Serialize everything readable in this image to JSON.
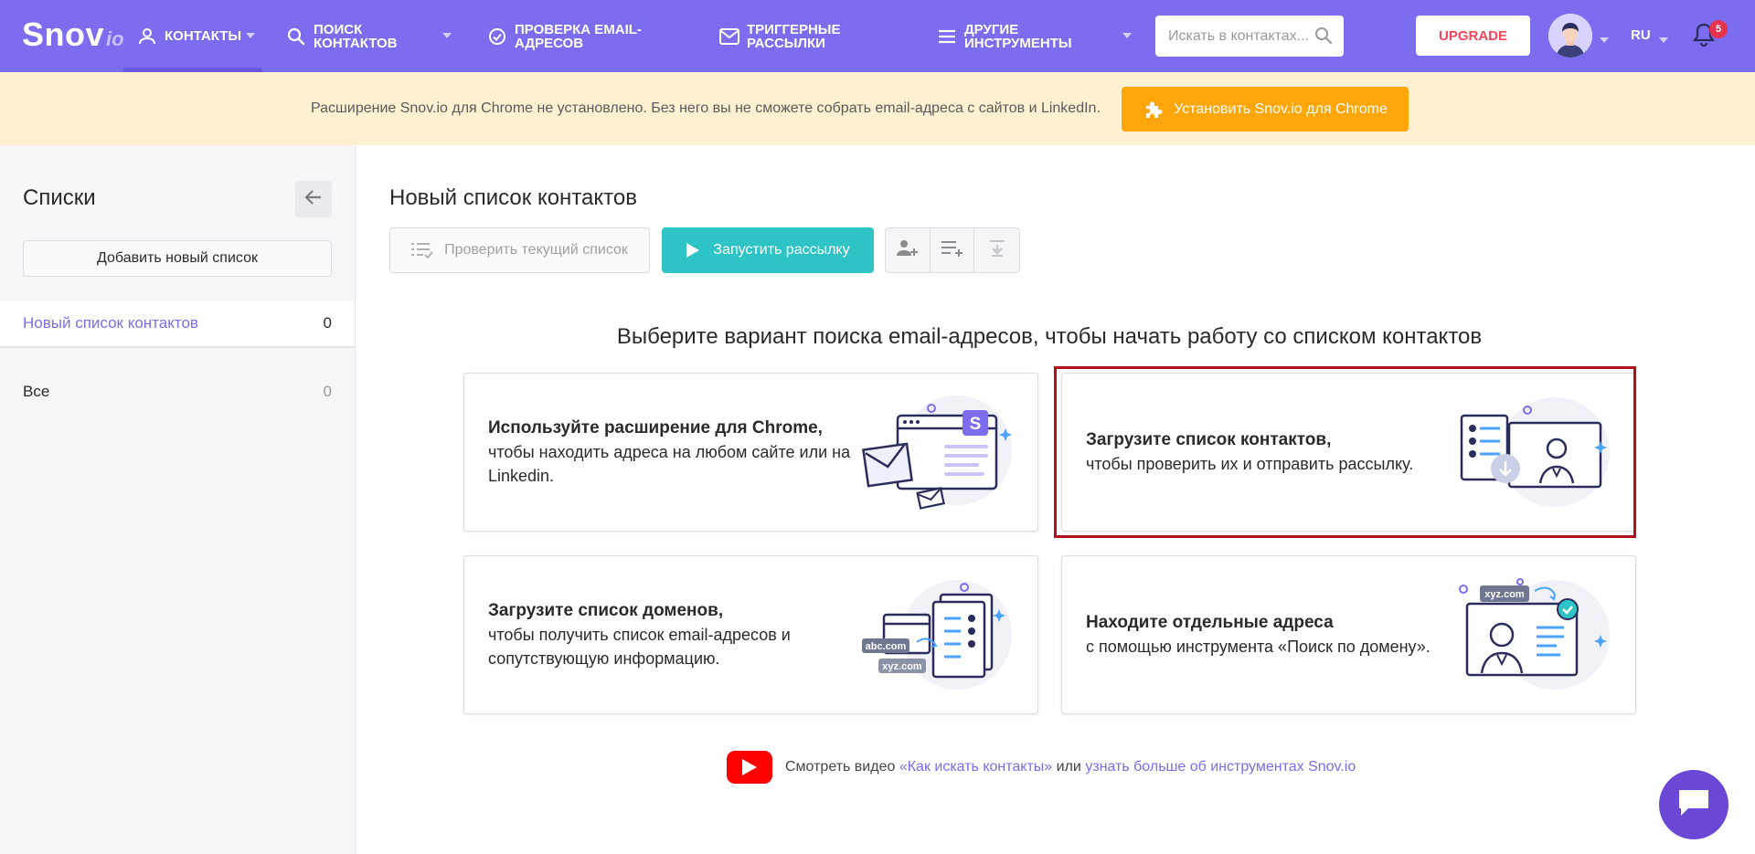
{
  "header": {
    "logo_main": "Snov",
    "logo_sub": "io",
    "nav": [
      {
        "line1": "КОНТАКТЫ",
        "line2": ""
      },
      {
        "line1": "ПОИСК",
        "line2": "КОНТАКТОВ"
      },
      {
        "line1": "ПРОВЕРКА EMAIL-",
        "line2": "АДРЕСОВ"
      },
      {
        "line1": "ТРИГГЕРНЫЕ",
        "line2": "РАССЫЛКИ"
      },
      {
        "line1": "ДРУГИЕ",
        "line2": "ИНСТРУМЕНТЫ"
      }
    ],
    "search_placeholder": "Искать в контактах...",
    "upgrade_label": "UPGRADE",
    "lang": "RU",
    "notifications": "5"
  },
  "banner": {
    "text": "Расширение Snov.io для Chrome не установлено. Без него вы не сможете собрать email-адреса с сайтов и LinkedIn.",
    "button": "Установить Snov.io для Chrome"
  },
  "sidebar": {
    "title": "Списки",
    "add_button": "Добавить новый список",
    "lists": [
      {
        "name": "Новый список контактов",
        "count": "0"
      },
      {
        "name": "Все",
        "count": "0"
      }
    ]
  },
  "main": {
    "title": "Новый список контактов",
    "check_button": "Проверить текущий список",
    "run_button": "Запустить рассылку",
    "choose_title": "Выберите вариант поиска email-адресов, чтобы начать работу со списком контактов",
    "cards": [
      {
        "title": "Используйте расширение для Chrome,",
        "desc": "чтобы находить адреса на любом сайте или на Linkedin."
      },
      {
        "title": "Загрузите список контактов,",
        "desc": "чтобы проверить их и отправить рассылку."
      },
      {
        "title": "Загрузите список доменов,",
        "desc": "чтобы получить список email-адресов и сопутствующую информацию."
      },
      {
        "title": "Находите отдельные адреса",
        "desc": "с помощью инструмента «Поиск по домену»."
      }
    ],
    "ill_labels": {
      "abc": "abc.com",
      "xyz": "xyz.com",
      "s_badge": "S"
    },
    "video": {
      "prefix": "Смотреть видео ",
      "link1": "«Как искать контакты»",
      "middle": " или ",
      "link2": "узнать больше об инструментах Snov.io"
    }
  },
  "colors": {
    "header": "#7c6cf0",
    "banner": "#fdf1d2",
    "install": "#ffa60a",
    "run": "#2ec4c6",
    "highlight": "#b3101e",
    "chat": "#6b47d6"
  }
}
